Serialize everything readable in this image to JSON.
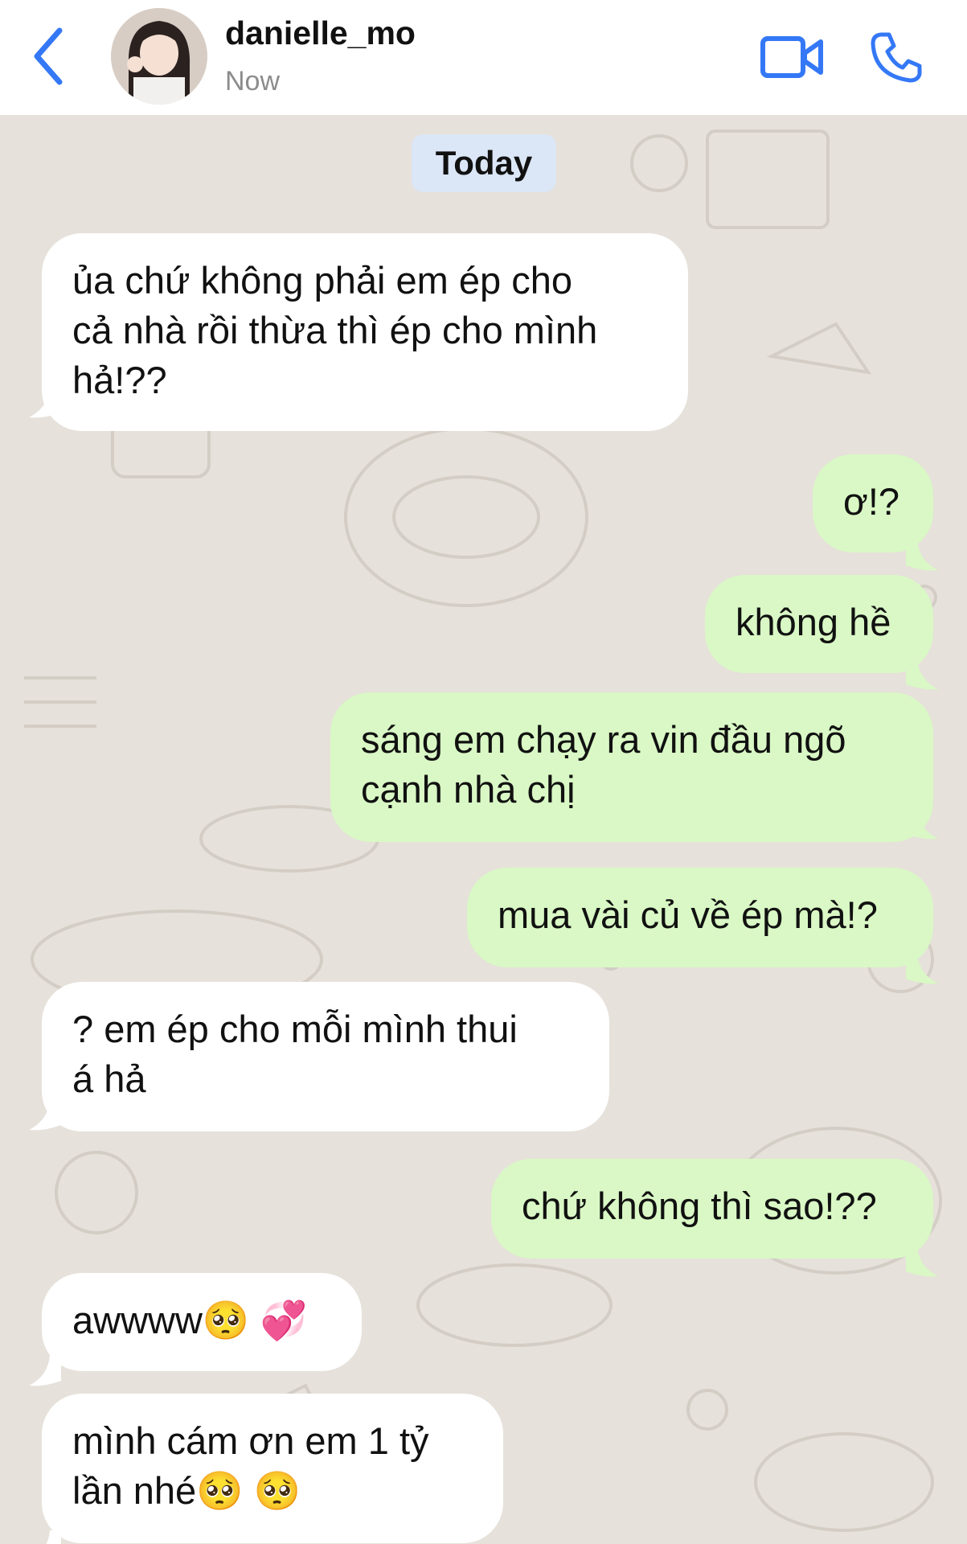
{
  "header": {
    "contact_name": "danielle_mo",
    "status": "Now",
    "icons": [
      "back-chevron-icon",
      "video-call-icon",
      "phone-call-icon"
    ],
    "accent_color": "#3478f6"
  },
  "chat": {
    "date_label": "Today",
    "incoming_color": "#ffffff",
    "outgoing_color": "#d9f8c5",
    "messages": [
      {
        "direction": "incoming",
        "text": "ủa chứ không phải em ép cho\ncả nhà rồi thừa thì ép cho mình\nhả!??"
      },
      {
        "direction": "outgoing",
        "text": "ơ!?"
      },
      {
        "direction": "outgoing",
        "text": "không hề"
      },
      {
        "direction": "outgoing",
        "text": "sáng em chạy ra vin đầu ngõ\ncạnh nhà chị"
      },
      {
        "direction": "outgoing",
        "text": "mua vài củ về ép mà!?"
      },
      {
        "direction": "incoming",
        "text": "? em ép cho mỗi mình thui\ná hả"
      },
      {
        "direction": "outgoing",
        "text": "chứ không thì sao!??"
      },
      {
        "direction": "incoming",
        "text": "awwww🥺 💞"
      },
      {
        "direction": "incoming",
        "text": "mình cám ơn em 1 tỷ\nlần nhé🥺 🥺"
      }
    ]
  }
}
